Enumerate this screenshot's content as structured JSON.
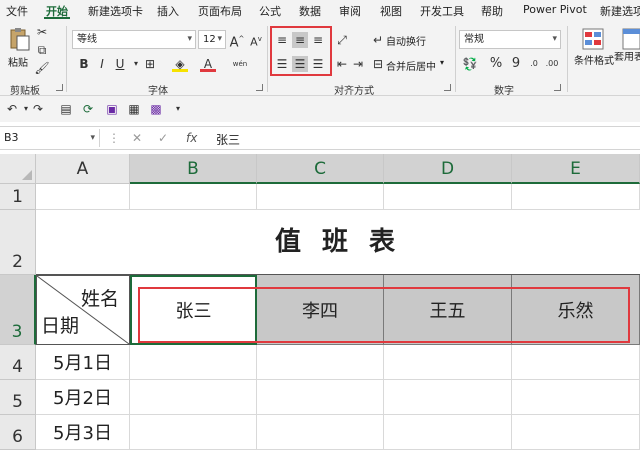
{
  "menu": {
    "tabs": [
      "文件",
      "开始",
      "新建选项卡",
      "插入",
      "页面布局",
      "公式",
      "数据",
      "审阅",
      "视图",
      "开发工具",
      "帮助",
      "Power Pivot",
      "新建选项"
    ],
    "active": "开始"
  },
  "ribbon": {
    "clipboard": {
      "paste_label": "粘贴",
      "group_label": "剪贴板"
    },
    "font": {
      "font_name": "等线",
      "font_size": "12",
      "bold": "B",
      "italic": "I",
      "underline": "U",
      "group_label": "字体"
    },
    "alignment": {
      "wrap_text": "自动换行",
      "merge_center": "合并后居中",
      "group_label": "对齐方式"
    },
    "number": {
      "format": "常规",
      "percent": "%",
      "comma": "9",
      "group_label": "数字"
    },
    "styles": {
      "conditional_format": "条件格式",
      "table_format": "套用表格格"
    }
  },
  "formula_bar": {
    "cell_ref": "B3",
    "fx": "fx",
    "value": "张三"
  },
  "sheet": {
    "columns": [
      "A",
      "B",
      "C",
      "D",
      "E"
    ],
    "rows": [
      "1",
      "2",
      "3",
      "4",
      "5",
      "6"
    ],
    "title": "值 班 表",
    "diag_top": "姓名",
    "diag_bottom": "日期",
    "names": [
      "张三",
      "李四",
      "王五",
      "乐然"
    ],
    "dates": [
      "5月1日",
      "5月2日",
      "5月3日"
    ]
  },
  "colors": {
    "accent": "#1d6b3a",
    "highlight": "#e0393e",
    "selected_gray": "#c8c8c8"
  }
}
